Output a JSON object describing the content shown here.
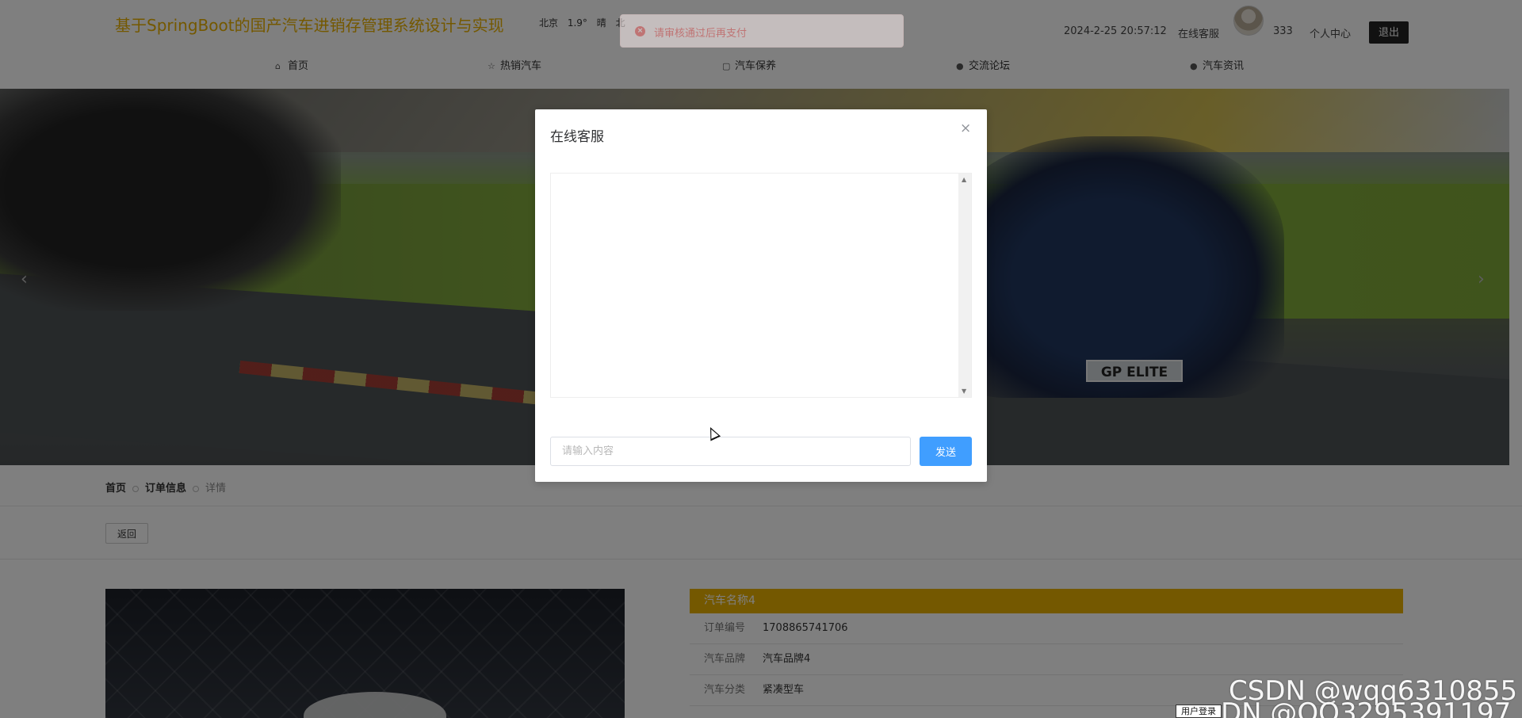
{
  "header": {
    "site_title": "基于SpringBoot的国产汽车进销存管理系统设计与实现",
    "weather": {
      "city": "北京",
      "temp": "1.9°",
      "condition": "晴",
      "extra": "北"
    },
    "datetime": "2024-2-25 20:57:12",
    "customer_service_label": "在线客服",
    "username": "333",
    "personal_center_label": "个人中心",
    "logout_label": "退出"
  },
  "toast": {
    "message": "请审核通过后再支付",
    "color": "#f56c6c"
  },
  "nav": {
    "items": [
      {
        "label": "首页",
        "icon": "home-icon"
      },
      {
        "label": "热销汽车",
        "icon": "star-icon"
      },
      {
        "label": "汽车保养",
        "icon": "bag-icon"
      },
      {
        "label": "交流论坛",
        "icon": "info-circle-icon"
      },
      {
        "label": "汽车资讯",
        "icon": "question-circle-icon"
      }
    ]
  },
  "banner": {
    "plate_text": "GP ELITE",
    "prev_arrow": "‹",
    "next_arrow": "›"
  },
  "breadcrumb": [
    "首页",
    "订单信息",
    "详情"
  ],
  "back_label": "返回",
  "order": {
    "car_name": "汽车名称4",
    "rows": [
      {
        "label": "订单编号",
        "value": "1708865741706"
      },
      {
        "label": "汽车品牌",
        "value": "汽车品牌4"
      },
      {
        "label": "汽车分类",
        "value": "紧凑型车"
      }
    ]
  },
  "modal": {
    "title": "在线客服",
    "close_glyph": "×",
    "input_placeholder": "请输入内容",
    "input_value": "",
    "send_label": "发送"
  },
  "watermark": {
    "line1": "CSDN @wqq6310855",
    "line2": "DN @QQ3295391197"
  },
  "login_tag": "用户登录",
  "colors": {
    "accent": "#e8b100",
    "primary": "#409eff",
    "error": "#f56c6c"
  }
}
